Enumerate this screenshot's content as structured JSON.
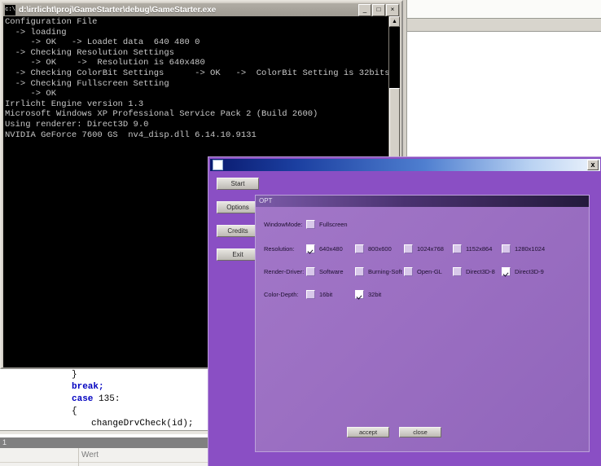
{
  "console_window": {
    "title": "d:\\irrlicht\\proj\\GameStarter\\debug\\GameStarter.exe",
    "icon": "console-icon",
    "icon_glyph": "c:\\",
    "minimize_label": "_",
    "maximize_label": "□",
    "close_label": "×",
    "scroll_up_glyph": "▲",
    "output": "Configuration File\n  -> loading\n     -> OK   -> Loadet data  640 480 0\n  -> Checking Resolution Settings\n     -> OK    ->  Resolution is 640x480\n  -> Checking ColorBit Settings      -> OK   ->  ColorBit Setting is 32bits\n  -> Checking Fullscreen Setting\n     -> OK\nIrrlicht Engine version 1.3\nMicrosoft Windows XP Professional Service Pack 2 (Build 2600)\nUsing renderer: Direct3D 9.0\nNVIDIA GeForce 7600 GS  nv4_disp.dll 6.14.10.9131"
  },
  "code_editor": {
    "lines": [
      {
        "indent": 0,
        "tokens": [
          {
            "t": "}",
            "k": "plain"
          }
        ]
      },
      {
        "indent": 0,
        "tokens": [
          {
            "t": "break;",
            "k": "kw"
          }
        ]
      },
      {
        "indent": 0,
        "tokens": [
          {
            "t": "case ",
            "k": "kw"
          },
          {
            "t": "135:",
            "k": "plain"
          }
        ]
      },
      {
        "indent": 0,
        "tokens": [
          {
            "t": "{",
            "k": "plain"
          }
        ]
      },
      {
        "indent": 1,
        "tokens": [
          {
            "t": "changeDrvCheck(id);",
            "k": "plain"
          }
        ]
      }
    ]
  },
  "watch_panel": {
    "row_number": "1",
    "value_column_label": "Wert"
  },
  "options_dialog": {
    "title": "",
    "icon": "app-icon",
    "close_label": "x",
    "menu_buttons": [
      {
        "label": "Start"
      },
      {
        "label": "Options"
      },
      {
        "label": "Credits"
      },
      {
        "label": "Exit"
      }
    ],
    "panel_header": "OPT",
    "rows": [
      {
        "label": "WindowMode:",
        "options": [
          {
            "label": "Fullscreen",
            "checked": false
          }
        ]
      },
      {
        "label": "Resolution:",
        "options": [
          {
            "label": "640x480",
            "checked": true
          },
          {
            "label": "800x600",
            "checked": false
          },
          {
            "label": "1024x768",
            "checked": false
          },
          {
            "label": "1152x864",
            "checked": false
          },
          {
            "label": "1280x1024",
            "checked": false
          }
        ]
      },
      {
        "label": "Render-Driver:",
        "options": [
          {
            "label": "Software",
            "checked": false
          },
          {
            "label": "Burning-Soft",
            "checked": false
          },
          {
            "label": "Open-GL",
            "checked": false
          },
          {
            "label": "Direct3D-8",
            "checked": false
          },
          {
            "label": "Direct3D-9",
            "checked": true
          }
        ]
      },
      {
        "label": "Color-Depth:",
        "options": [
          {
            "label": "16bit",
            "checked": false
          },
          {
            "label": "32bit",
            "checked": true
          }
        ]
      }
    ],
    "accept_label": "accept",
    "close_button_label": "close"
  },
  "colors": {
    "dialog_purple": "#8a4fc4",
    "panel_purple": "#9b6fc2",
    "titlebar_blue": "#1b3fa0",
    "console_black": "#000000",
    "keyword_blue": "#0000c0"
  }
}
